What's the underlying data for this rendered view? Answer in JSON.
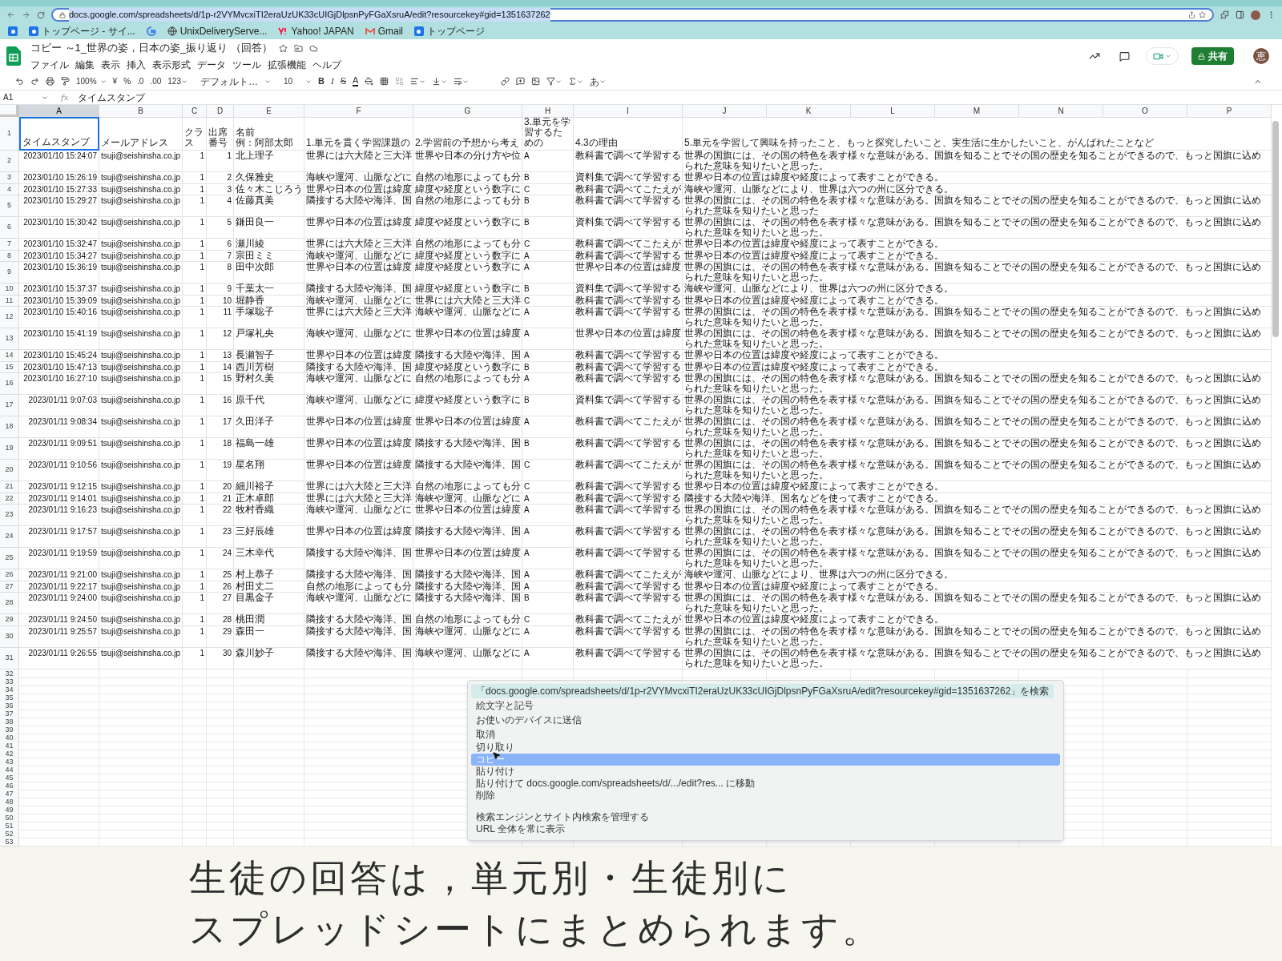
{
  "browser": {
    "url": "docs.google.com/spreadsheets/d/1p-r2VYMvcxiTI2eraUzUK33cUIGjDlpsnPyFGaXsruA/edit?resourcekey#gid=1351637262",
    "bookmarks": [
      {
        "kind": "site"
      },
      {
        "kind": "site",
        "label": "トップページ - サイ..."
      },
      {
        "kind": "google"
      },
      {
        "kind": "globe",
        "label": "UnixDeliveryServe..."
      },
      {
        "kind": "yahoo",
        "label": "Yahoo! JAPAN"
      },
      {
        "kind": "gmail",
        "label": "Gmail"
      },
      {
        "kind": "site",
        "label": "トップページ"
      }
    ]
  },
  "document": {
    "title": "コピー ～1_世界の姿，日本の姿_振り返り （回答）",
    "menus": [
      "ファイル",
      "編集",
      "表示",
      "挿入",
      "表示形式",
      "データ",
      "ツール",
      "拡張機能",
      "ヘルプ"
    ],
    "share": "共有",
    "avatar": "恵"
  },
  "toolbar": {
    "zoom": "100%",
    "currency": "¥",
    "percent": "%",
    "dec_less": ".0",
    "dec_more": ".00",
    "format": "123",
    "font": "デフォルト…",
    "size": "10",
    "bold": "B",
    "italic": "I",
    "strike": "S",
    "font_color": "A",
    "input": "あ"
  },
  "formula_bar": {
    "cell": "A1",
    "fx": "fx",
    "content": "タイムスタンプ"
  },
  "sheet": {
    "columns": [
      {
        "label": "A",
        "selected": true
      },
      {
        "label": "B",
        "selected": false
      },
      {
        "label": "C",
        "selected": false
      },
      {
        "label": "D",
        "selected": false
      },
      {
        "label": "E",
        "selected": false
      },
      {
        "label": "F",
        "selected": false
      },
      {
        "label": "G",
        "selected": false
      },
      {
        "label": "H",
        "selected": false
      },
      {
        "label": "I",
        "selected": false
      },
      {
        "label": "J",
        "selected": false
      },
      {
        "label": "K",
        "selected": false
      },
      {
        "label": "L",
        "selected": false
      },
      {
        "label": "M",
        "selected": false
      },
      {
        "label": "N",
        "selected": false
      },
      {
        "label": "O",
        "selected": false
      },
      {
        "label": "P",
        "selected": false
      }
    ],
    "header": {
      "n": "1",
      "name_hint": "例：阿部太郎",
      "cells": [
        "タイムスタンプ",
        "メールアドレス",
        "クラス",
        "出席番号",
        "名前",
        "1.単元を貫く学習課題の",
        "2.学習前の予想から考え",
        "3.単元を学習するための",
        "4.3の理由",
        "5.単元を学習して興味を持ったこと、もっと探究したいこと、実生活に生かしたいこと、がんばれたことなど"
      ]
    },
    "rows": [
      {
        "n": "2",
        "cells": [
          "2023/01/10 15:24:07",
          "tsuji@seishinsha.co.jp",
          "1",
          "1",
          "北上理子",
          "世界には六大陸と三大洋",
          "世界や日本の分け方や位",
          "A",
          "教科書で調べて学習する",
          "世界の国旗には、その国の特色を表す様々な意味がある。国旗を知ることでその国の歴史を知ることができるので、もっと国旗に込められた意味を知りたいと思った。"
        ]
      },
      {
        "n": "3",
        "cells": [
          "2023/01/10 15:26:19",
          "tsuji@seishinsha.co.jp",
          "1",
          "2",
          "久保雅史",
          "海峡や運河、山脈などに",
          "自然の地形によっても分",
          "B",
          "資料集で調べて学習する",
          "世界や日本の位置は緯度や経度によって表すことができる。"
        ]
      },
      {
        "n": "4",
        "cells": [
          "2023/01/10 15:27:33",
          "tsuji@seishinsha.co.jp",
          "1",
          "3",
          "佐々木こじろう",
          "世界や日本の位置は緯度",
          "緯度や経度という数字に",
          "C",
          "教科書で調べてこたえが",
          "海峡や運河、山脈などにより、世界は六つの州に区分できる。"
        ]
      },
      {
        "n": "5",
        "cells": [
          "2023/01/10 15:29:27",
          "tsuji@seishinsha.co.jp",
          "1",
          "4",
          "佐藤真美",
          "隣接する大陸や海洋、国",
          "自然の地形によっても分",
          "B",
          "教科書で調べて学習する",
          "世界の国旗には、その国の特色を表す様々な意味がある。国旗を知ることでその国の歴史を知ることができるので、もっと国旗に込められた意味を知りたいと思った"
        ]
      },
      {
        "n": "6",
        "cells": [
          "2023/01/10 15:30:42",
          "tsuji@seishinsha.co.jp",
          "1",
          "5",
          "鎌田良一",
          "世界や日本の位置は緯度",
          "緯度や経度という数字に",
          "B",
          "資料集で調べて学習する",
          "世界の国旗には、その国の特色を表す様々な意味がある。国旗を知ることでその国の歴史を知ることができるので、もっと国旗に込められた意味を知りたいと思った。"
        ]
      },
      {
        "n": "7",
        "cells": [
          "2023/01/10 15:32:47",
          "tsuji@seishinsha.co.jp",
          "1",
          "6",
          "瀬川綾",
          "世界には六大陸と三大洋",
          "自然の地形によっても分",
          "C",
          "教科書で調べてこたえが",
          "世界や日本の位置は緯度や経度によって表すことができる。"
        ]
      },
      {
        "n": "8",
        "cells": [
          "2023/01/10 15:34:27",
          "tsuji@seishinsha.co.jp",
          "1",
          "7",
          "宗田ミミ",
          "海峡や運河、山脈などに",
          "緯度や経度という数字に",
          "A",
          "教科書で調べて学習する",
          "世界や日本の位置は緯度や経度によって表すことができる。"
        ]
      },
      {
        "n": "9",
        "cells": [
          "2023/01/10 15:36:19",
          "tsuji@seishinsha.co.jp",
          "1",
          "8",
          "田中次郎",
          "世界や日本の位置は緯度",
          "緯度や経度という数字に",
          "A",
          "世界や日本の位置は緯度",
          "世界の国旗には、その国の特色を表す様々な意味がある。国旗を知ることでその国の歴史を知ることができるので、もっと国旗に込められた意味を知りたいと思った。"
        ]
      },
      {
        "n": "10",
        "cells": [
          "2023/01/10 15:37:37",
          "tsuji@seishinsha.co.jp",
          "1",
          "9",
          "千葉太一",
          "隣接する大陸や海洋、国",
          "緯度や経度という数字に",
          "B",
          "資料集で調べて学習する",
          "海峡や運河、山脈などにより、世界は六つの州に区分できる。"
        ]
      },
      {
        "n": "11",
        "cells": [
          "2023/01/10 15:39:09",
          "tsuji@seishinsha.co.jp",
          "1",
          "10",
          "堀静香",
          "海峡や運河、山脈などに",
          "世界には六大陸と三大洋",
          "C",
          "教科書で調べて学習する",
          "世界や日本の位置は緯度や経度によって表すことができる。"
        ]
      },
      {
        "n": "12",
        "cells": [
          "2023/01/10 15:40:16",
          "tsuji@seishinsha.co.jp",
          "1",
          "11",
          "手塚聡子",
          "世界には六大陸と三大洋",
          "海峡や運河、山脈などに",
          "A",
          "教科書で調べて学習する",
          "世界の国旗には、その国の特色を表す様々な意味がある。国旗を知ることでその国の歴史を知ることができるので、もっと国旗に込められた意味を知りたいと思った。"
        ]
      },
      {
        "n": "13",
        "cells": [
          "2023/01/10 15:41:19",
          "tsuji@seishinsha.co.jp",
          "1",
          "12",
          "戸塚礼央",
          "海峡や運河、山脈などに",
          "世界や日本の位置は緯度",
          "A",
          "世界や日本の位置は緯度",
          "世界の国旗には、その国の特色を表す様々な意味がある。国旗を知ることでその国の歴史を知ることができるので、もっと国旗に込められた意味を知りたいと思った。"
        ]
      },
      {
        "n": "14",
        "cells": [
          "2023/01/10 15:45:24",
          "tsuji@seishinsha.co.jp",
          "1",
          "13",
          "長瀬智子",
          "世界や日本の位置は緯度",
          "隣接する大陸や海洋、国",
          "A",
          "教科書で調べて学習する",
          "世界や日本の位置は緯度や経度によって表すことができる。"
        ]
      },
      {
        "n": "15",
        "cells": [
          "2023/01/10 15:47:13",
          "tsuji@seishinsha.co.jp",
          "1",
          "14",
          "西川芳樹",
          "隣接する大陸や海洋、国",
          "緯度や経度という数字に",
          "B",
          "教科書で調べて学習する",
          "世界や日本の位置は緯度や経度によって表すことができる。"
        ]
      },
      {
        "n": "16",
        "cells": [
          "2023/01/10 16:27:10",
          "tsuji@seishinsha.co.jp",
          "1",
          "15",
          "野村久美",
          "海峡や運河、山脈などに",
          "自然の地形によっても分",
          "A",
          "教科書で調べて学習する",
          "世界の国旗には、その国の特色を表す様々な意味がある。国旗を知ることでその国の歴史を知ることができるので、もっと国旗に込められた意味を知りたいと思った。"
        ]
      },
      {
        "n": "17",
        "cells": [
          "2023/01/11 9:07:03",
          "tsuji@seishinsha.co.jp",
          "1",
          "16",
          "原千代",
          "海峡や運河、山脈などに",
          "緯度や経度という数字に",
          "B",
          "資料集で調べて学習する",
          "世界の国旗には、その国の特色を表す様々な意味がある。国旗を知ることでその国の歴史を知ることができるので、もっと国旗に込められた意味を知りたいと思った。"
        ]
      },
      {
        "n": "18",
        "cells": [
          "2023/01/11 9:08:34",
          "tsuji@seishinsha.co.jp",
          "1",
          "17",
          "久田洋子",
          "世界や日本の位置は緯度",
          "世界や日本の位置は緯度",
          "A",
          "教科書で調べてこたえが",
          "世界の国旗には、その国の特色を表す様々な意味がある。国旗を知ることでその国の歴史を知ることができるので、もっと国旗に込められた意味を知りたいと思った。"
        ]
      },
      {
        "n": "19",
        "cells": [
          "2023/01/11 9:09:51",
          "tsuji@seishinsha.co.jp",
          "1",
          "18",
          "福島一雄",
          "世界や日本の位置は緯度",
          "隣接する大陸や海洋、国",
          "B",
          "教科書で調べて学習する",
          "世界の国旗には、その国の特色を表す様々な意味がある。国旗を知ることでその国の歴史を知ることができるので、もっと国旗に込められた意味を知りたいと思った。"
        ]
      },
      {
        "n": "20",
        "cells": [
          "2023/01/11 9:10:56",
          "tsuji@seishinsha.co.jp",
          "1",
          "19",
          "星名翔",
          "世界や日本の位置は緯度",
          "隣接する大陸や海洋、国",
          "C",
          "教科書で調べてこたえが",
          "世界の国旗には、その国の特色を表す様々な意味がある。国旗を知ることでその国の歴史を知ることができるので、もっと国旗に込められた意味を知りたいと思った。"
        ]
      },
      {
        "n": "21",
        "cells": [
          "2023/01/11 9:12:15",
          "tsuji@seishinsha.co.jp",
          "1",
          "20",
          "細川裕子",
          "世界には六大陸と三大洋",
          "自然の地形によっても分",
          "C",
          "教科書で調べて学習する",
          "世界や日本の位置は緯度や経度によって表すことができる。"
        ]
      },
      {
        "n": "22",
        "cells": [
          "2023/01/11 9:14:01",
          "tsuji@seishinsha.co.jp",
          "1",
          "21",
          "正木卓郎",
          "世界には六大陸と三大洋",
          "海峡や運河、山脈などに",
          "A",
          "教科書で調べて学習する",
          "隣接する大陸や海洋、国名などを使って表すことができる。"
        ]
      },
      {
        "n": "23",
        "cells": [
          "2023/01/11 9:16:23",
          "tsuji@seishinsha.co.jp",
          "1",
          "22",
          "牧村香織",
          "海峡や運河、山脈などに",
          "世界や日本の位置は緯度",
          "A",
          "教科書で調べて学習する",
          "世界の国旗には、その国の特色を表す様々な意味がある。国旗を知ることでその国の歴史を知ることができるので、もっと国旗に込められた意味を知りたいと思った。"
        ]
      },
      {
        "n": "24",
        "cells": [
          "2023/01/11 9:17:57",
          "tsuji@seishinsha.co.jp",
          "1",
          "23",
          "三好辰雄",
          "世界や日本の位置は緯度",
          "隣接する大陸や海洋、国",
          "A",
          "教科書で調べて学習する",
          "世界の国旗には、その国の特色を表す様々な意味がある。国旗を知ることでその国の歴史を知ることができるので、もっと国旗に込められた意味を知りたいと思った。"
        ]
      },
      {
        "n": "25",
        "cells": [
          "2023/01/11 9:19:59",
          "tsuji@seishinsha.co.jp",
          "1",
          "24",
          "三木幸代",
          "隣接する大陸や海洋、国",
          "世界や日本の位置は緯度",
          "A",
          "教科書で調べて学習する",
          "世界の国旗には、その国の特色を表す様々な意味がある。国旗を知ることでその国の歴史を知ることができるので、もっと国旗に込められた意味を知りたいと思った。"
        ]
      },
      {
        "n": "26",
        "cells": [
          "2023/01/11 9:21:00",
          "tsuji@seishinsha.co.jp",
          "1",
          "25",
          "村上恭子",
          "隣接する大陸や海洋、国",
          "隣接する大陸や海洋、国",
          "A",
          "教科書で調べてこたえが",
          "海峡や運河、山脈などにより、世界は六つの州に区分できる。"
        ]
      },
      {
        "n": "27",
        "cells": [
          "2023/01/11 9:22:17",
          "tsuji@seishinsha.co.jp",
          "1",
          "26",
          "村田丈二",
          "自然の地形によっても分",
          "隣接する大陸や海洋、国",
          "A",
          "教科書で調べて学習する",
          "世界や日本の位置は緯度や経度によって表すことができる。"
        ]
      },
      {
        "n": "28",
        "cells": [
          "2023/01/11 9:24:00",
          "tsuji@seishinsha.co.jp",
          "1",
          "27",
          "目黒金子",
          "海峡や運河、山脈などに",
          "隣接する大陸や海洋、国",
          "B",
          "教科書で調べて学習する",
          "世界の国旗には、その国の特色を表す様々な意味がある。国旗を知ることでその国の歴史を知ることができるので、もっと国旗に込められた意味を知りたいと思った。"
        ]
      },
      {
        "n": "29",
        "cells": [
          "2023/01/11 9:24:50",
          "tsuji@seishinsha.co.jp",
          "1",
          "28",
          "桃田潤",
          "隣接する大陸や海洋、国",
          "自然の地形によっても分",
          "C",
          "教科書で調べてこたえが",
          "世界や日本の位置は緯度や経度によって表すことができる。"
        ]
      },
      {
        "n": "30",
        "cells": [
          "2023/01/11 9:25:57",
          "tsuji@seishinsha.co.jp",
          "1",
          "29",
          "森田一",
          "隣接する大陸や海洋、国",
          "海峡や運河、山脈などに",
          "A",
          "教科書で調べて学習する",
          "世界の国旗には、その国の特色を表す様々な意味がある。国旗を知ることでその国の歴史を知ることができるので、もっと国旗に込められた意味を知りたいと思った。"
        ]
      },
      {
        "n": "31",
        "cells": [
          "2023/01/11 9:26:55",
          "tsuji@seishinsha.co.jp",
          "1",
          "30",
          "森川妙子",
          "隣接する大陸や海洋、国",
          "海峡や運河、山脈などに",
          "A",
          "教科書で調べて学習する",
          "世界の国旗には、その国の特色を表す様々な意味がある。国旗を知ることでその国の歴史を知ることができるので、もっと国旗に込められた意味を知りたいと思った。"
        ]
      }
    ],
    "empty_rows": [
      "32",
      "33",
      "34",
      "35",
      "36",
      "37",
      "38",
      "39",
      "40",
      "41",
      "42",
      "43",
      "44",
      "45",
      "46",
      "47",
      "48",
      "49",
      "50",
      "51",
      "52",
      "53"
    ]
  },
  "menu": {
    "items": [
      {
        "label": "「docs.google.com/spreadsheets/d/1p-r2VYMvcxiTI2eraUzUK33cUIGjDlpsnPyFGaXsruA/edit?resourcekey#gid=1351637262」を検索",
        "selected": false
      },
      {
        "label": "絵文字と記号",
        "selected": false
      },
      {
        "label": "お使いのデバイスに送信",
        "selected": false
      },
      {
        "label": "取消",
        "selected": false
      },
      {
        "label": "切り取り",
        "selected": false
      },
      {
        "label": "コピー",
        "selected": true
      },
      {
        "label": "貼り付け",
        "selected": false
      },
      {
        "label": "貼り付けて docs.google.com/spreadsheets/d/.../edit?res... に移動",
        "selected": false
      },
      {
        "label": "削除",
        "selected": false
      },
      {
        "label": "検索エンジンとサイト内検索を管理する",
        "selected": false
      },
      {
        "label": "URL 全体を常に表示",
        "selected": false
      }
    ]
  },
  "caption": [
    "生徒の回答は，単元別・生徒別に",
    "スプレッドシートにまとめられます。"
  ]
}
